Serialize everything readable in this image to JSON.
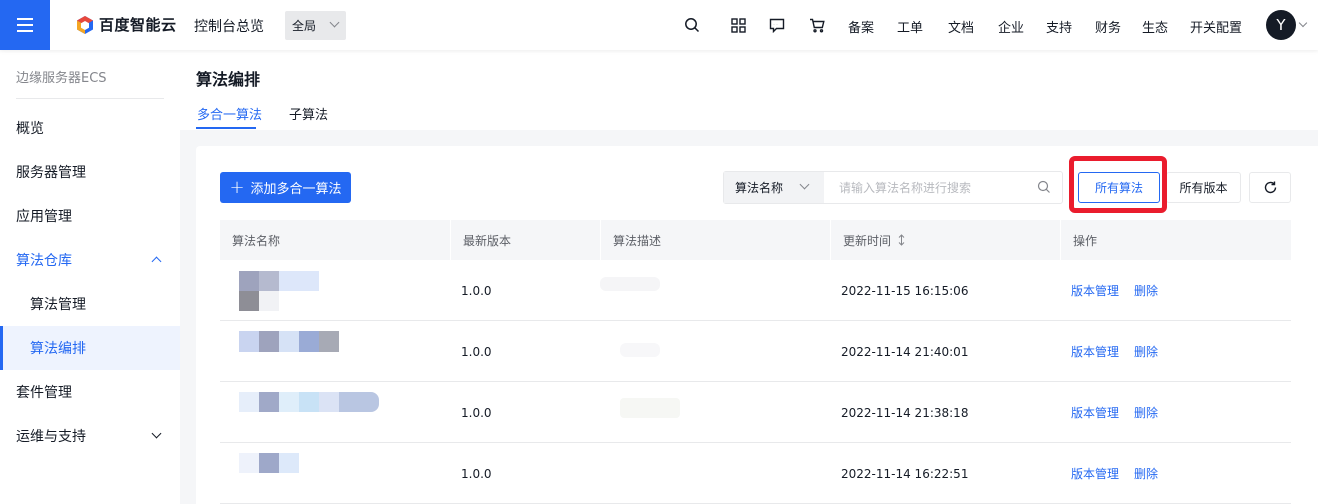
{
  "topbar": {
    "brand": "百度智能云",
    "console_title": "控制台总览",
    "region": "全局",
    "links": [
      "备案",
      "工单",
      "文档",
      "企业",
      "支持",
      "财务",
      "生态",
      "开关配置"
    ],
    "avatar_letter": "Y"
  },
  "sidebar": {
    "title": "边缘服务器ECS",
    "items": [
      {
        "label": "概览"
      },
      {
        "label": "服务器管理"
      },
      {
        "label": "应用管理"
      },
      {
        "label": "算法仓库"
      },
      {
        "label": "算法管理"
      },
      {
        "label": "算法编排"
      },
      {
        "label": "套件管理"
      },
      {
        "label": "运维与支持"
      }
    ]
  },
  "page": {
    "title": "算法编排",
    "tabs": [
      {
        "label": "多合一算法"
      },
      {
        "label": "子算法"
      }
    ]
  },
  "toolbar": {
    "add_label": "添加多合一算法",
    "search_field": "算法名称",
    "search_placeholder": "请输入算法名称进行搜索",
    "filter_all": "所有算法",
    "filter_versions": "所有版本"
  },
  "table": {
    "columns": [
      "算法名称",
      "最新版本",
      "算法描述",
      "更新时间",
      "操作"
    ],
    "rows": [
      {
        "version": "1.0.0",
        "updated": "2022-11-15 16:15:06"
      },
      {
        "version": "1.0.0",
        "updated": "2022-11-14 21:40:01"
      },
      {
        "version": "1.0.0",
        "updated": "2022-11-14 21:38:18"
      },
      {
        "version": "1.0.0",
        "updated": "2022-11-14 16:22:51"
      }
    ],
    "actions": {
      "versions": "版本管理",
      "delete": "删除"
    }
  },
  "colors": {
    "accent": "#2468f2",
    "highlight": "#ea1c2d"
  }
}
